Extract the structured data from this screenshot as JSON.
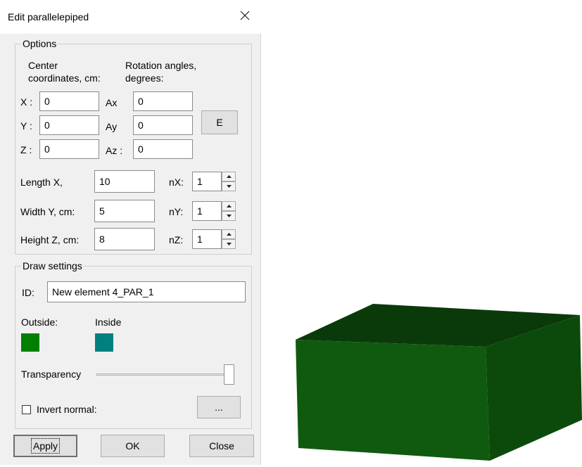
{
  "dialog": {
    "title": "Edit parallelepiped",
    "close_glyph": "✕"
  },
  "options": {
    "legend": "Options",
    "center_heading_1": "Center",
    "center_heading_2": "coordinates, cm:",
    "rotation_heading_1": "Rotation angles,",
    "rotation_heading_2": "degrees:",
    "x_label": "X :",
    "y_label": "Y :",
    "z_label": "Z :",
    "x_value": "0",
    "y_value": "0",
    "z_value": "0",
    "ax_label": "Ax",
    "ay_label": "Ay",
    "az_label": "Az :",
    "ax_value": "0",
    "ay_value": "0",
    "az_value": "0",
    "e_button": "E",
    "length_label": "Length X,",
    "width_label": "Width Y, cm:",
    "height_label": "Height Z, cm:",
    "length_value": "10",
    "width_value": "5",
    "height_value": "8",
    "nx_label": "nX:",
    "ny_label": "nY:",
    "nz_label": "nZ:",
    "nx_value": "1",
    "ny_value": "1",
    "nz_value": "1"
  },
  "draw": {
    "legend": "Draw settings",
    "id_label": "ID:",
    "id_value": "New element 4_PAR_1",
    "outside_label": "Outside:",
    "inside_label": "Inside",
    "outside_color": "#007f00",
    "inside_color": "#008080",
    "transparency_label": "Transparency",
    "transparency_value": 1.0,
    "invert_label": "Invert normal:",
    "invert_checked": false,
    "ellipsis_button": "..."
  },
  "buttons": {
    "apply": "Apply",
    "ok": "OK",
    "close": "Close"
  },
  "viewport": {
    "shape": "box",
    "top_face_color": "#0a3a0a",
    "front_face_color": "#0f5a0f",
    "side_face_color": "#0c4a0c"
  }
}
